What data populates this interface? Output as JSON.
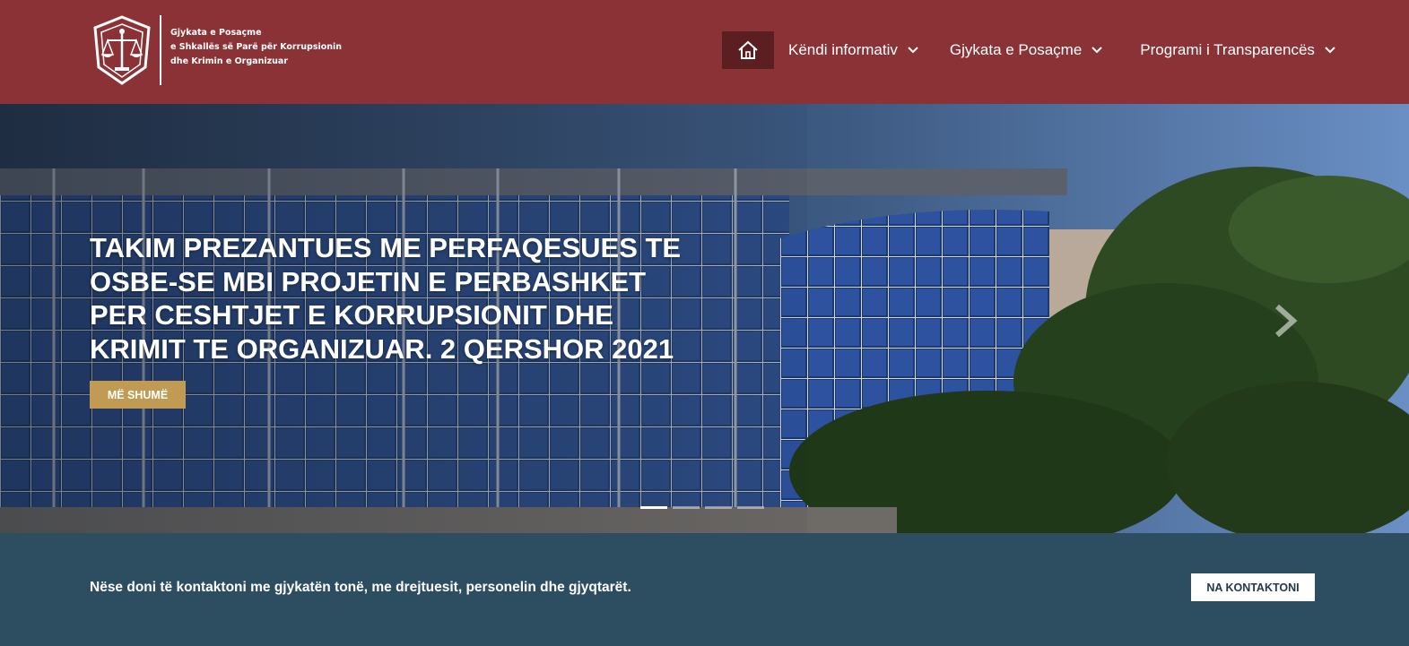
{
  "header": {
    "logo_lines": [
      "Gjykata e Posaçme",
      "e Shkallës së Parë për Korrupsionin",
      "dhe Krimin e Organizuar"
    ],
    "colors": {
      "background": "#8a3235",
      "home_bg": "#5b1f21"
    }
  },
  "nav": {
    "home_icon": "home-icon",
    "items": [
      {
        "label": "Këndi informativ",
        "icon": "chevron-down-icon"
      },
      {
        "label": "Gjykata e Posaçme",
        "icon": "chevron-down-icon"
      },
      {
        "label": "Programi i Transparencës",
        "icon": "chevron-down-icon"
      }
    ]
  },
  "hero": {
    "title_lines": [
      "TAKIM PREZANTUES ME PERFAQESUES TE",
      "OSBE-SE MBI PROJETIN E PERBASHKET",
      "PER CESHTJET E KORRUPSIONIT DHE",
      "KRIMIT TE ORGANIZUAR. 2 QERSHOR 2021"
    ],
    "button_label": "MË SHUMË",
    "button_color": "#c19a53",
    "next_icon": "chevron-right-icon",
    "slide_count": 4,
    "active_slide": 1
  },
  "contact": {
    "text": "Nëse doni të kontaktoni me gjykatën tonë, me drejtuesit, personelin dhe gjyqtarët.",
    "button_label": "NA KONTAKTONI",
    "background": "#2d4e60"
  }
}
